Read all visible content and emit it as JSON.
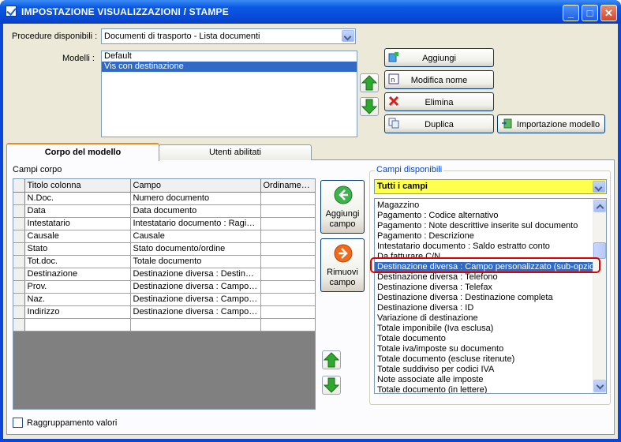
{
  "window": {
    "title": "IMPOSTAZIONE VISUALIZZAZIONI / STAMPE",
    "minimize": "_",
    "maximize": "□",
    "close": "✕"
  },
  "top": {
    "procedure_label": "Procedure disponibili :",
    "procedure_value": "Documenti di trasporto - Lista documenti",
    "modelli_label": "Modelli :",
    "modelli": [
      "Default",
      "Vis con destinazione"
    ],
    "modelli_selected": 1,
    "buttons": {
      "aggiungi": "Aggiungi",
      "modifica_nome": "Modifica nome",
      "elimina": "Elimina",
      "duplica": "Duplica",
      "importazione": "Importazione modello"
    }
  },
  "tabs": {
    "corpo": "Corpo del modello",
    "utenti": "Utenti abilitati"
  },
  "corpo": {
    "campi_corpo_label": "Campi corpo",
    "columns": [
      "Titolo colonna",
      "Campo",
      "Ordinamento"
    ],
    "rows": [
      [
        "N.Doc.",
        "Numero documento",
        ""
      ],
      [
        "Data",
        "Data documento",
        ""
      ],
      [
        "Intestatario",
        "Intestatario documento : Ragion...",
        ""
      ],
      [
        "Causale",
        "Causale",
        ""
      ],
      [
        "Stato",
        "Stato documento/ordine",
        ""
      ],
      [
        "Tot.doc.",
        "Totale documento",
        ""
      ],
      [
        "Destinazione",
        "Destinazione diversa : Destinazi...",
        ""
      ],
      [
        "Prov.",
        "Destinazione diversa : Campo p...",
        ""
      ],
      [
        "Naz.",
        "Destinazione diversa : Campo p...",
        ""
      ],
      [
        "Indirizzo",
        "Destinazione diversa : Campo p...",
        ""
      ]
    ],
    "aggiungi_campo": [
      "Aggiungi",
      "campo"
    ],
    "rimuovi_campo": [
      "Rimuovi",
      "campo"
    ],
    "raggruppamento": "Raggruppamento valori"
  },
  "campi_disponibili": {
    "title": "Campi disponibili",
    "filter": "Tutti i campi",
    "items": [
      "Magazzino",
      "Pagamento : Codice alternativo",
      "Pagamento : Note descrittive inserite sul documento",
      "Pagamento : Descrizione",
      "Intestatario documento : Saldo estratto conto",
      "Da fatturare C/N",
      "Destinazione diversa : Campo personalizzato (sub-opzione",
      "Destinazione diversa : Telefono",
      "Destinazione diversa : Telefax",
      "Destinazione diversa : Destinazione completa",
      "Destinazione diversa : ID",
      "Variazione di destinazione",
      "Totale imponibile (Iva esclusa)",
      "Totale documento",
      "Totale iva/imposte su documento",
      "Totale documento (escluse ritenute)",
      "Totale suddiviso per codici IVA",
      "Note associate alle imposte",
      "Totale documento (in lettere)"
    ],
    "selected": 6
  },
  "colors": {
    "title_bar": "#0a5ae6",
    "selection": "#316ac5",
    "filter_bg": "#ffff4d",
    "highlight": "#e00000",
    "arrow_green": "#2fa82f",
    "arrow_orange": "#f06a1a"
  }
}
